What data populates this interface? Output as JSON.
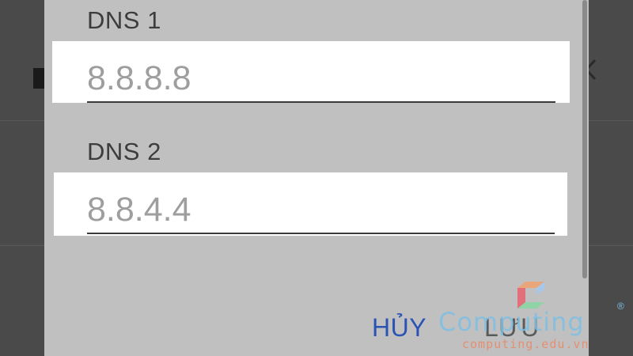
{
  "dialog": {
    "dns1": {
      "label": "DNS 1",
      "placeholder": "8.8.8.8"
    },
    "dns2": {
      "label": "DNS 2",
      "placeholder": "8.8.4.4"
    },
    "actions": {
      "cancel_label": "HỦY",
      "save_label": "LƯU"
    }
  },
  "watermark": {
    "name": "Computing",
    "registered": "®",
    "url": "computing.edu.vn"
  },
  "colors": {
    "dialog_bg": "#c0c0c0",
    "cancel_blue": "#2a53b3",
    "watermark_blue": "#7fbfe4",
    "watermark_orange": "#e88a6a"
  }
}
